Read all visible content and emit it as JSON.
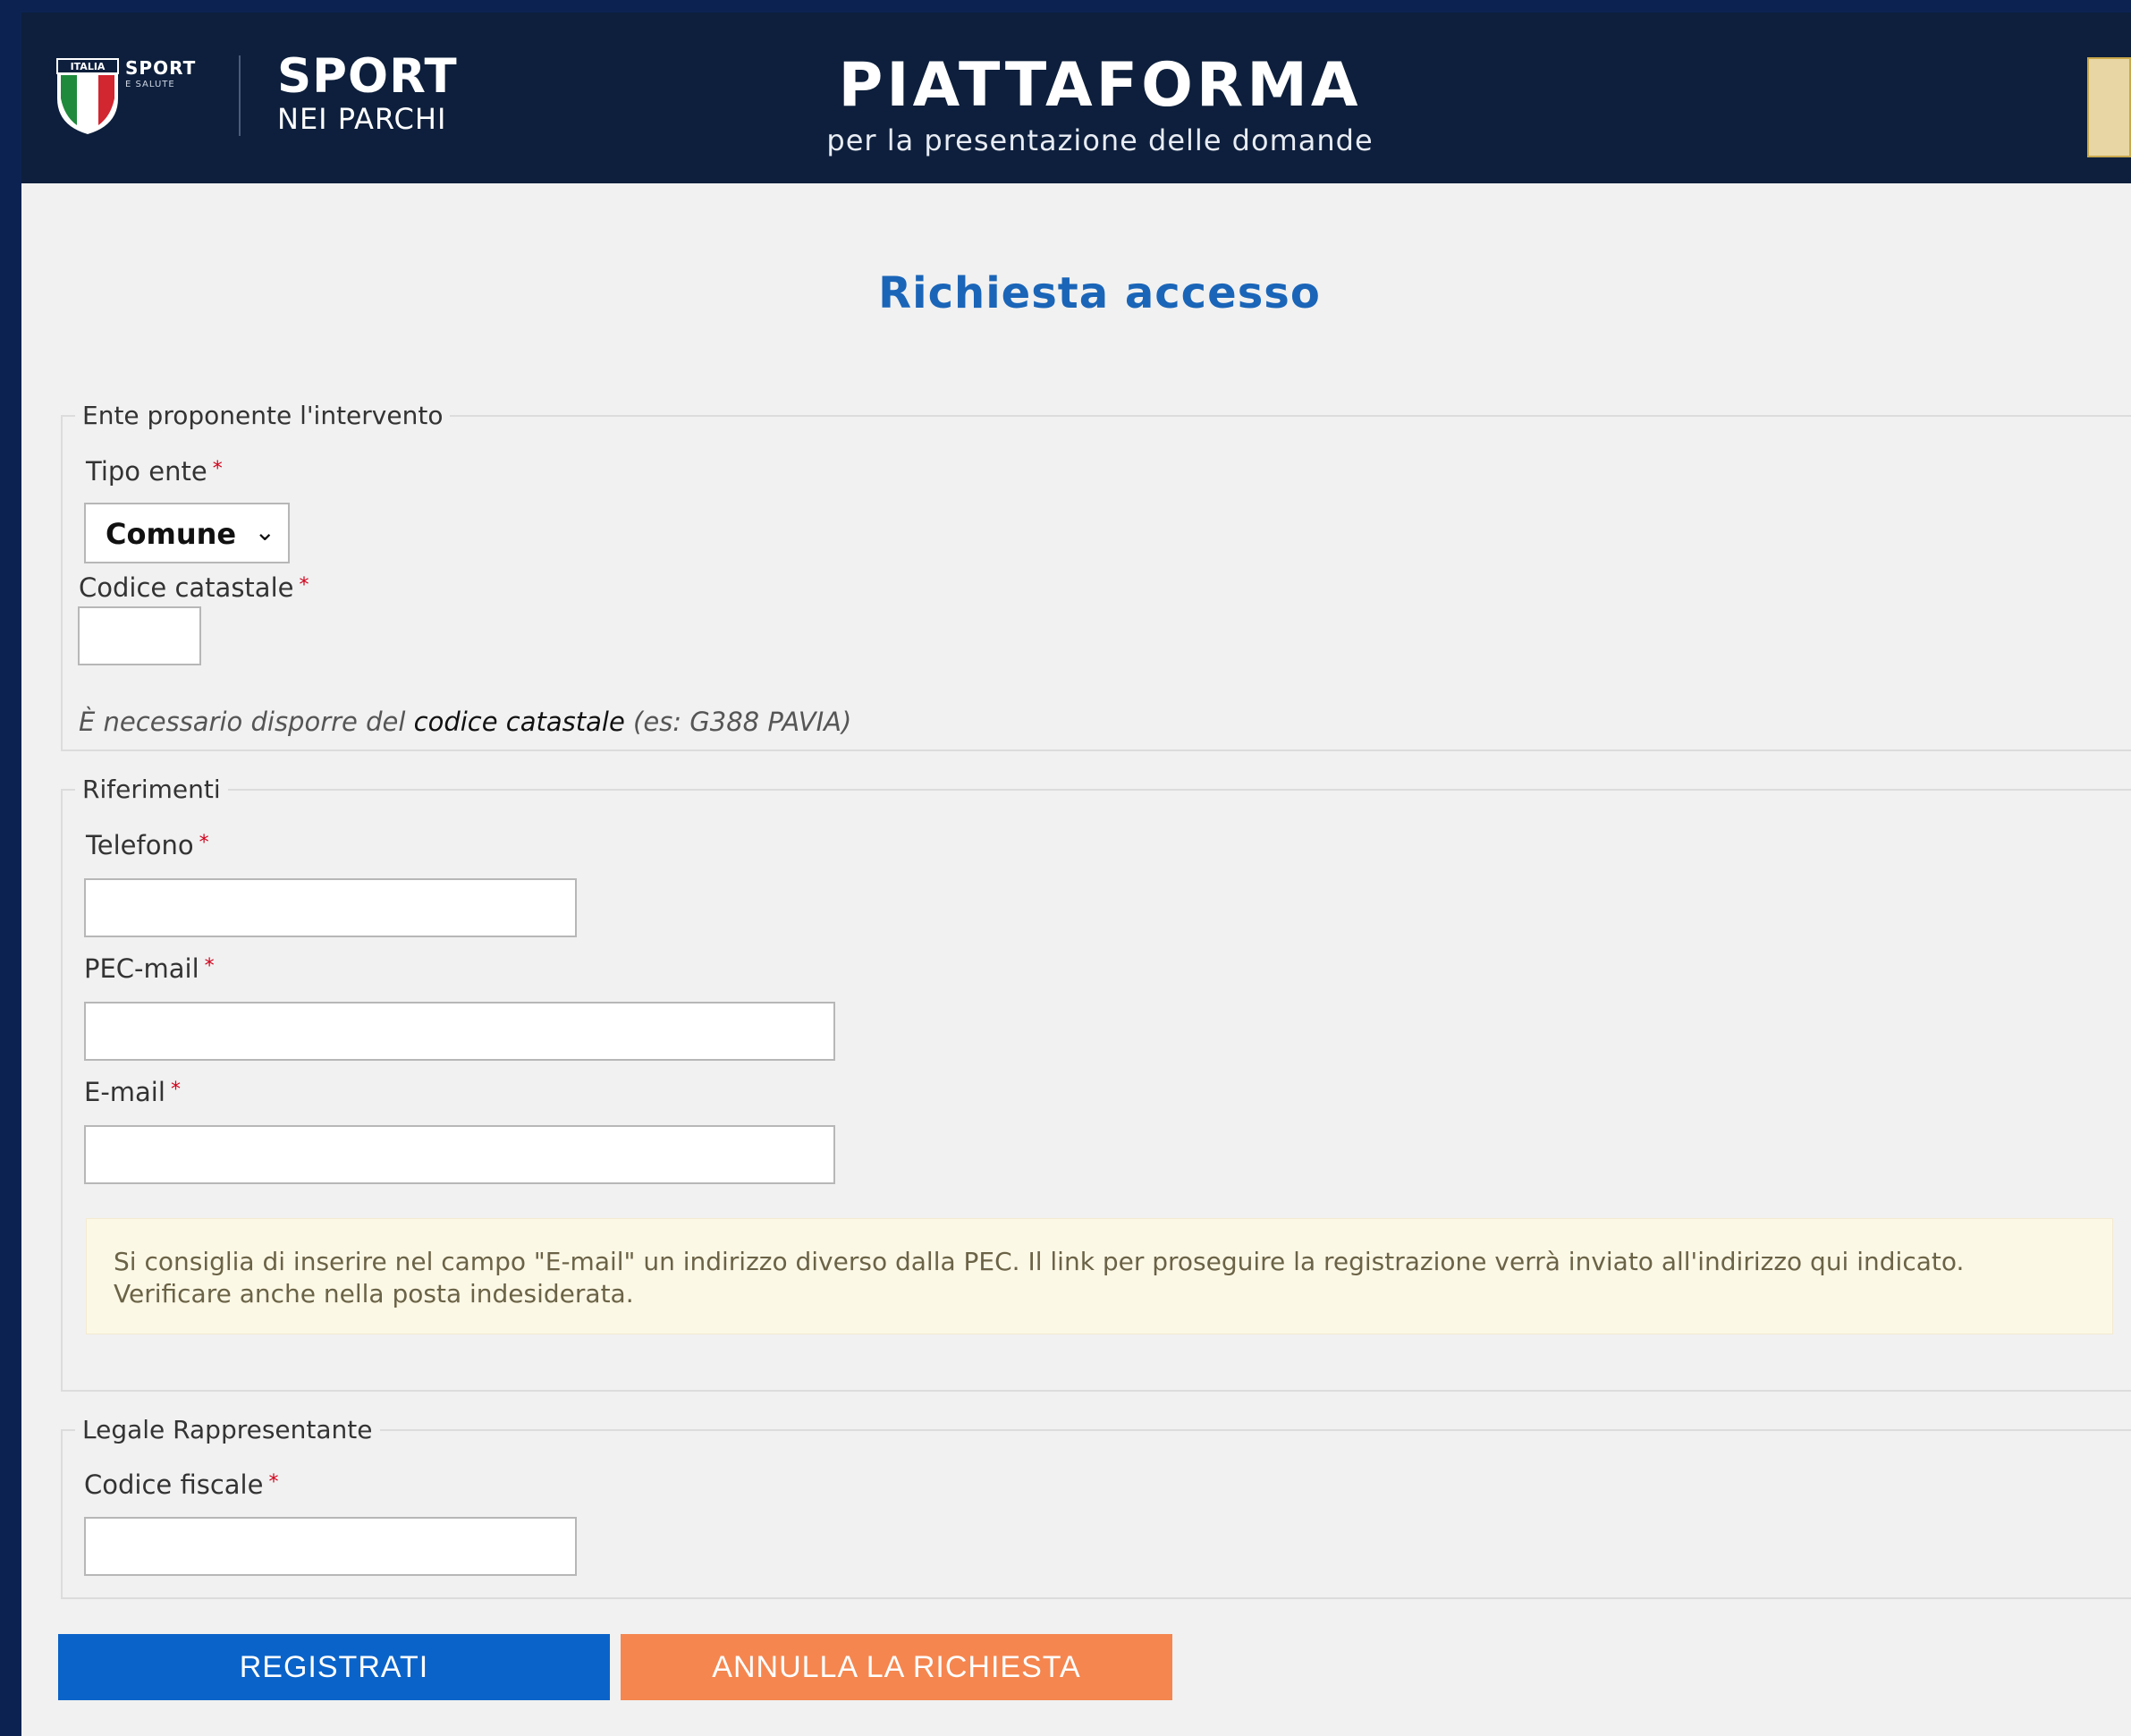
{
  "header": {
    "brand_top": "SPORT",
    "brand_top_sub": "E SALUTE",
    "shield_text": "ITALIA",
    "sport_title": "SPORT",
    "sport_subtitle": "NEI PARCHI",
    "platform_title": "PIATTAFORMA",
    "platform_subtitle": "per la presentazione delle domande"
  },
  "page_title": "Richiesta accesso",
  "section_ente": {
    "legend": "Ente proponente l'intervento",
    "tipo_label": "Tipo ente",
    "tipo_value": "Comune",
    "codice_label": "Codice catastale",
    "codice_value": "",
    "hint_prefix": "È necessario disporre del ",
    "hint_strong": "codice catastale",
    "hint_suffix": " (es: G388 PAVIA)"
  },
  "section_riferimenti": {
    "legend": "Riferimenti",
    "telefono_label": "Telefono",
    "pec_label": "PEC-mail",
    "email_label": "E-mail",
    "alert_line1": "Si consiglia di inserire nel campo \"E-mail\" un indirizzo diverso dalla PEC. Il link per proseguire la registrazione verrà inviato all'indirizzo qui indicato.",
    "alert_line2": "Verificare anche nella posta indesiderata."
  },
  "section_legale": {
    "legend": "Legale Rappresentante",
    "cf_label": "Codice fiscale"
  },
  "required_marker": "*",
  "buttons": {
    "register": "REGISTRATI",
    "cancel": "ANNULLA LA RICHIESTA"
  },
  "colors": {
    "header_bg": "#0d1f3c",
    "title_blue": "#1a65b8",
    "register_bg": "#0a63c9",
    "cancel_bg": "#f5864f",
    "alert_bg": "#fcf8e6"
  }
}
